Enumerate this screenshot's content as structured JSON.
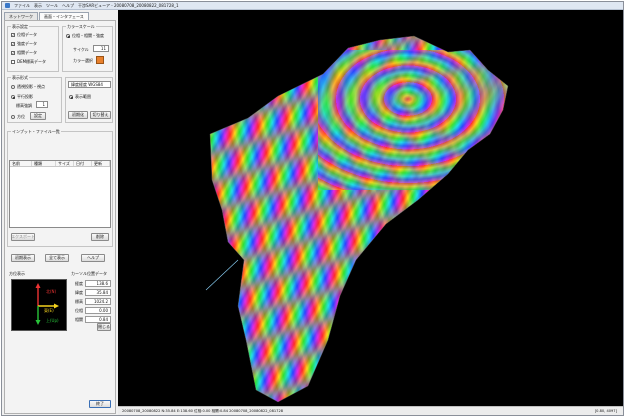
{
  "titlebar": {
    "menu": [
      "ファイル",
      "表示",
      "ツール",
      "ヘルプ"
    ],
    "title": "干渉SARビューア ‑ 20080708_20080822_081728_1"
  },
  "tabs": [
    {
      "label": "ネットワーク"
    },
    {
      "label": "画面・インタフェース"
    }
  ],
  "display_group": {
    "title": "表示設定",
    "items": [
      {
        "label": "位相データ",
        "checked": true
      },
      {
        "label": "強度データ",
        "checked": true
      },
      {
        "label": "相関データ",
        "checked": true
      },
      {
        "label": "DEM標高データ",
        "checked": false
      }
    ]
  },
  "color_group": {
    "title": "カラースケール",
    "radio_label": "位相・相関・強度",
    "range_label": "サイクル",
    "range_value": "11",
    "color_label": "カラー選択"
  },
  "view_group": {
    "title": "表示形式",
    "perspective_label": "透視投影・視点",
    "ortho_label": "平行投影",
    "tilt_label": "標高強調",
    "tilt_value": "1",
    "grid_label": "方位",
    "reset_label": "設定"
  },
  "proj_group": {
    "select_value": "緯度経度 WGS84",
    "radio_label": "表示範囲"
  },
  "buttons": {
    "btn_a": "初期化",
    "btn_b": "切り替え"
  },
  "list_group": {
    "title": "インプット・ファイル一覧",
    "columns": [
      "名前",
      "種類",
      "サイズ",
      "日付",
      "更新"
    ],
    "footer_left": "エクスポート",
    "footer_right": "削除"
  },
  "bottom_buttons": [
    "初期表示",
    "全て表示",
    "ヘルプ"
  ],
  "axis": {
    "title": "方位表示",
    "north": "北(N)",
    "east": "東(E)",
    "up": "上(Up)"
  },
  "cursor": {
    "title": "カーソル位置データ",
    "rows": [
      {
        "key": "経度",
        "value": "138.6"
      },
      {
        "key": "緯度",
        "value": "35.84"
      },
      {
        "key": "標高",
        "value": "1024.2"
      },
      {
        "key": "位相",
        "value": "0.00"
      },
      {
        "key": "相関",
        "value": "0.84"
      }
    ],
    "ok_label": "閉じる"
  },
  "exit_button": "終了",
  "statusbar": {
    "left": "20080708_20080822  N:35.84  E:138.60  位相:0.00  相関:0.84  20080708_20080822_081728",
    "right": "[0.80, 4097]"
  }
}
